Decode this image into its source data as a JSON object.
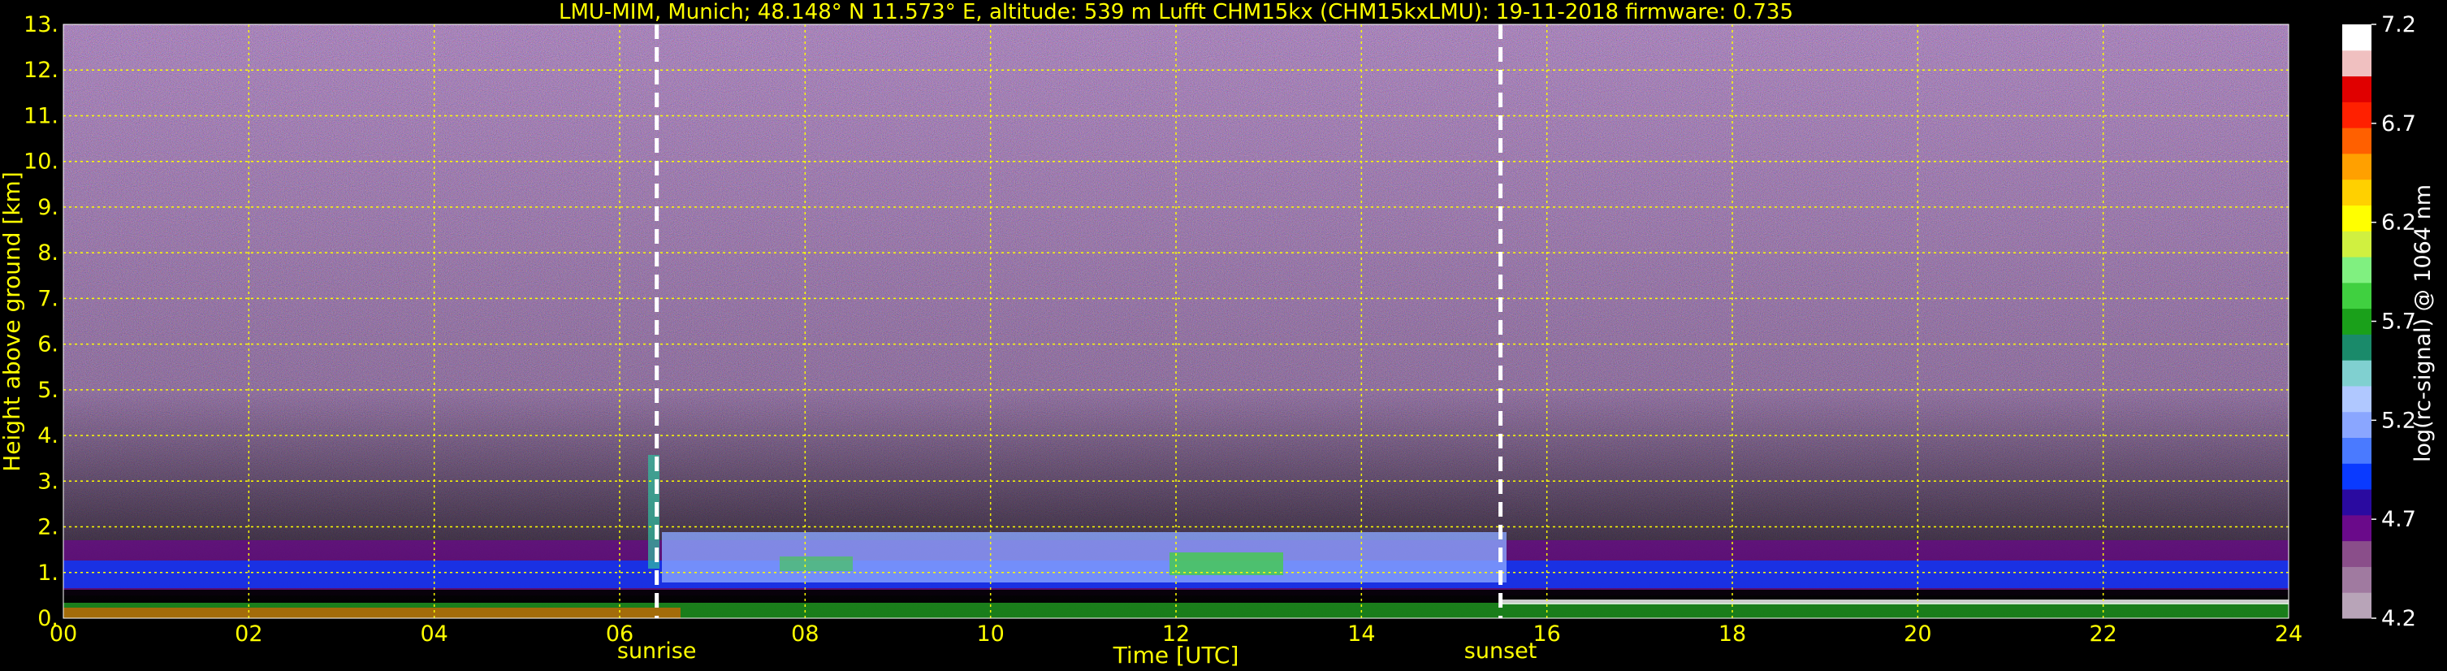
{
  "chart_data": {
    "type": "heatmap",
    "title": "LMU-MIM, Munich; 48.148° N 11.573° E, altitude: 539 m     Lufft CHM15kx (CHM15kxLMU): 19-11-2018     firmware: 0.735",
    "xlabel": "Time [UTC]",
    "ylabel": "Height above ground [km]",
    "xlim": [
      0,
      24
    ],
    "ylim": [
      0,
      13
    ],
    "x_ticks": [
      "00",
      "02",
      "04",
      "06",
      "08",
      "10",
      "12",
      "14",
      "16",
      "18",
      "20",
      "22",
      "24"
    ],
    "y_ticks": [
      "0.",
      "1.",
      "2.",
      "3.",
      "4.",
      "5.",
      "6.",
      "7.",
      "8.",
      "9.",
      "10.",
      "11.",
      "12.",
      "13."
    ],
    "grid": true,
    "annotations": [
      {
        "label": "sunrise",
        "x": 6.4
      },
      {
        "label": "sunset",
        "x": 15.5
      }
    ],
    "colorbar": {
      "label": "log(rc-signal) @ 1064 nm",
      "range": [
        4.2,
        7.2
      ],
      "ticks": [
        "4.2",
        "4.7",
        "5.2",
        "5.7",
        "6.2",
        "6.7",
        "7.2"
      ]
    },
    "features": [
      {
        "name": "boundary layer aerosol (blue/purple band)",
        "height_range_km": [
          0.6,
          1.6
        ],
        "time_range_h": [
          0,
          24
        ]
      },
      {
        "name": "near-surface strong return",
        "height_range_km": [
          0.0,
          0.5
        ],
        "time_range_h": [
          0,
          24
        ]
      }
    ]
  },
  "colors": {
    "text": "#ffff00",
    "grid": "#ffff00",
    "background": "#000000",
    "colorbar_colors": [
      "#b8a4b8",
      "#a07aa0",
      "#8a4e8a",
      "#6a0a8a",
      "#2a0aa0",
      "#0a3aff",
      "#4a7aff",
      "#8aa6ff",
      "#b0c8ff",
      "#80d0d0",
      "#1a8a6a",
      "#1aa01a",
      "#40d040",
      "#80f080",
      "#d0f040",
      "#ffff00",
      "#ffd000",
      "#ffa000",
      "#ff6000",
      "#ff2000",
      "#e00000",
      "#f0c0c0",
      "#ffffff"
    ]
  }
}
